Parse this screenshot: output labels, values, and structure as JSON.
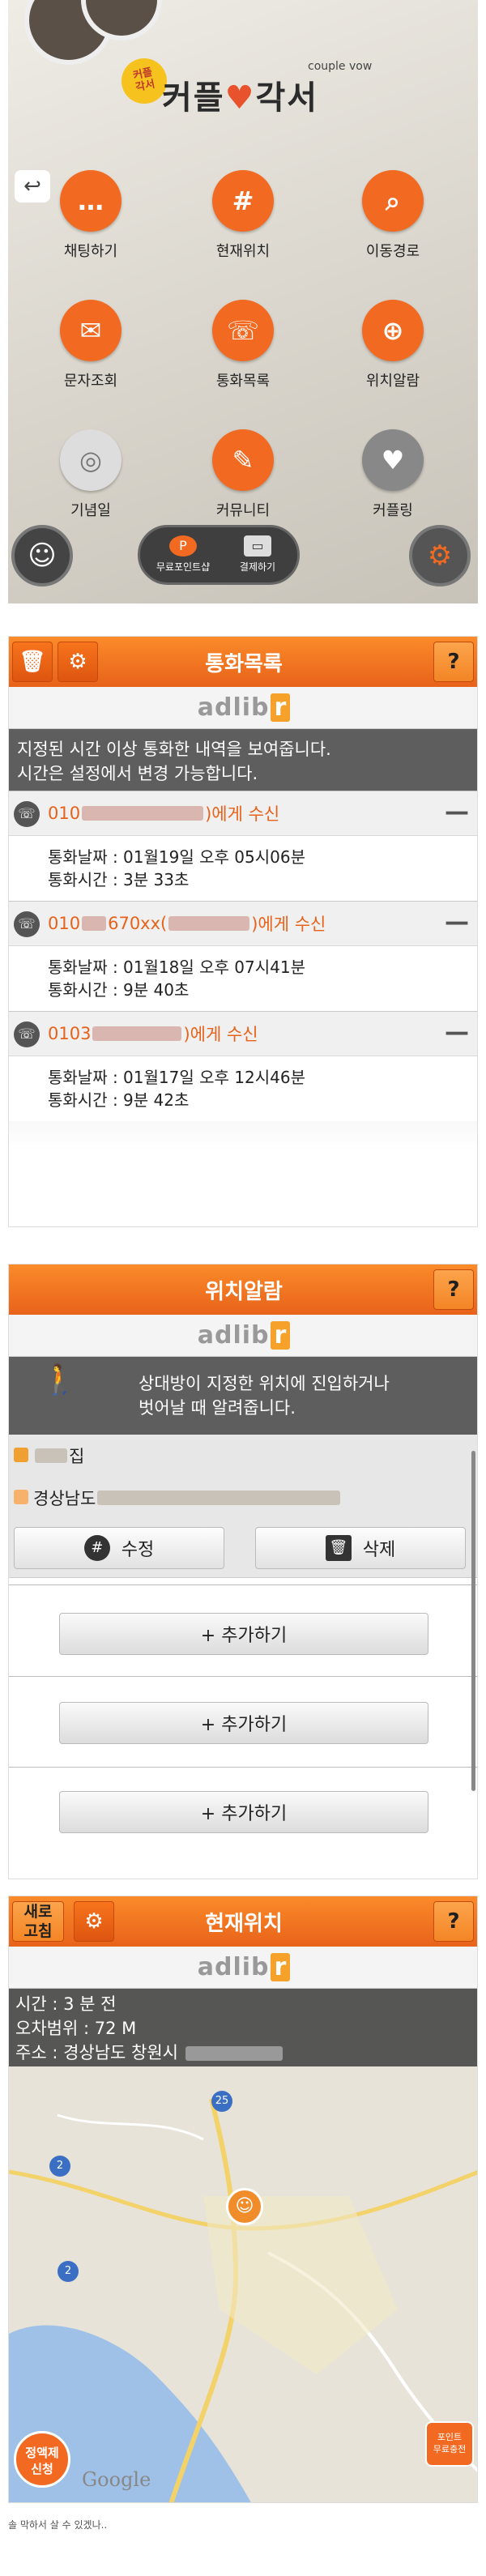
{
  "home": {
    "logo_badge": "커플\n각서",
    "logo_title_left": "커플",
    "logo_title_right": "각서",
    "logo_sub": "couple vow",
    "menu": [
      {
        "label": "채팅하기",
        "icon": "chat-bubble-icon"
      },
      {
        "label": "현재위치",
        "icon": "location-pin-icon"
      },
      {
        "label": "이동경로",
        "icon": "route-search-icon"
      },
      {
        "label": "문자조회",
        "icon": "envelope-icon"
      },
      {
        "label": "통화목록",
        "icon": "phone-person-icon"
      },
      {
        "label": "위치알람",
        "icon": "target-icon"
      },
      {
        "label": "기념일",
        "icon": "rings-icon"
      },
      {
        "label": "커뮤니티",
        "icon": "notebook-icon"
      },
      {
        "label": "커플링",
        "icon": "heart-phone-icon"
      }
    ],
    "free_points_label": "무료포인트샵",
    "payment_label": "결제하기"
  },
  "calls": {
    "title": "통화목록",
    "ad": "adlib",
    "ad_r": "r",
    "banner": "지정된 시간 이상 통화한 내역을 보여줍니다.\n시간은 설정에서 변경 가능합니다.",
    "items": [
      {
        "number": "010",
        "suffix": ")에게 수신",
        "date": "통화날짜 : 01월19일 오후 05시06분",
        "duration": "통화시간 : 3분 33초"
      },
      {
        "number": "010",
        "suffix": "670xx(",
        "suffix2": ")에게 수신",
        "date": "통화날짜 : 01월18일 오후 07시41분",
        "duration": "통화시간 : 9분 40초"
      },
      {
        "number": "0103",
        "suffix": ")에게 수신",
        "date": "통화날짜 : 01월17일 오후 12시46분",
        "duration": "통화시간 : 9분 42초"
      }
    ]
  },
  "alarm": {
    "title": "위치알람",
    "ad": "adlib",
    "ad_r": "r",
    "banner": "상대방이 지정한 위치에 진입하거나\n벗어날 때 알려줍니다.",
    "place_name": "집",
    "address": "경상남도",
    "edit_label": "수정",
    "delete_label": "삭제",
    "add_label": "+ 추가하기"
  },
  "location": {
    "title": "현재위치",
    "refresh_label": "새로\n고침",
    "ad": "adlib",
    "ad_r": "r",
    "time": "시간 : 3 분 전",
    "accuracy": "오차범위 : 72 M",
    "address": "주소 : 경상남도 창원시",
    "plan_label": "정액제\n신청",
    "point_label": "포인트\n무료충전",
    "map_badges": [
      "25",
      "2",
      "2"
    ],
    "google": "Google"
  },
  "footer": "솔 막하서 살 수 있겠나..",
  "colors": {
    "accent": "#f26a21",
    "titlebar": "#f07a22",
    "banner": "#5e5e5e"
  }
}
